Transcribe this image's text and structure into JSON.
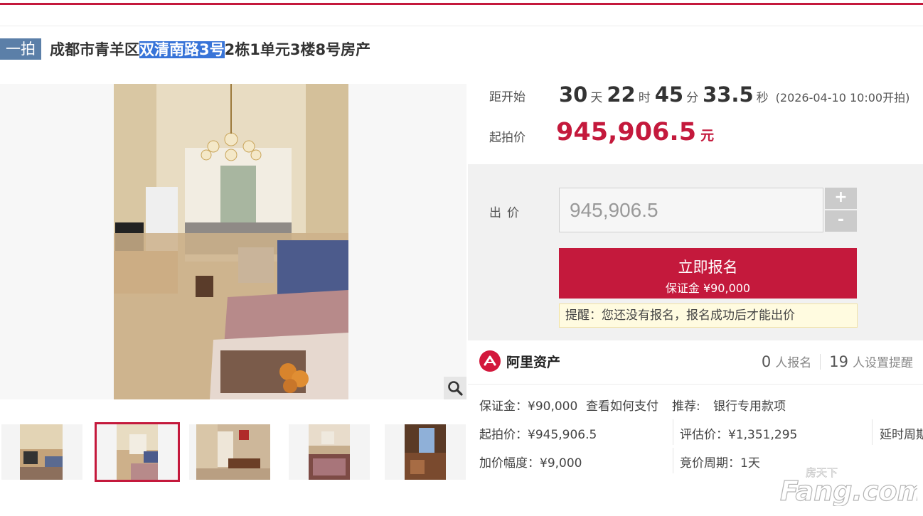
{
  "listing": {
    "tag": "一拍",
    "title_pre": "成都市青羊区",
    "title_highlight": "双清南路3号",
    "title_post": "2栋1单元3楼8号房产"
  },
  "countdown": {
    "label": "距开始",
    "days": "30",
    "days_unit": "天",
    "hours": "22",
    "hours_unit": "时",
    "minutes": "45",
    "minutes_unit": "分",
    "seconds": "33.5",
    "seconds_unit": "秒",
    "start_note": "(2026-04-10 10:00开拍)"
  },
  "start_price": {
    "label": "起拍价",
    "value": "945,906.5",
    "unit": "元"
  },
  "bid": {
    "label": "出价",
    "input_value": "945,906.5",
    "plus": "+",
    "minus": "-",
    "signup_label": "立即报名",
    "deposit_line": "保证金 ¥90,000",
    "reminder": "提醒：您还没有报名，报名成功后才能出价"
  },
  "platform": {
    "name": "阿里资产",
    "signup_count": "0",
    "signup_text": "人报名",
    "remind_count": "19",
    "remind_text": "人设置提醒"
  },
  "details": {
    "deposit": "保证金：¥90,000",
    "how_to_pay": "查看如何支付",
    "recommend_label": "推荐:",
    "recommend_value": "银行专用款项",
    "start_price": "起拍价：¥945,906.5",
    "appraisal": "评估价：¥1,351,295",
    "delay": "延时周期",
    "increment": "加价幅度：¥9,000",
    "cycle": "竞价周期：1天"
  },
  "watermark": {
    "line1": "房天下",
    "line2": "Fang.com"
  },
  "colors": {
    "accent": "#c4193c",
    "tag_bg": "#5b7fa8",
    "link": "#2b6db4"
  },
  "icons": {
    "zoom": "magnifier-icon",
    "platform": "ali-assets-logo-icon"
  }
}
